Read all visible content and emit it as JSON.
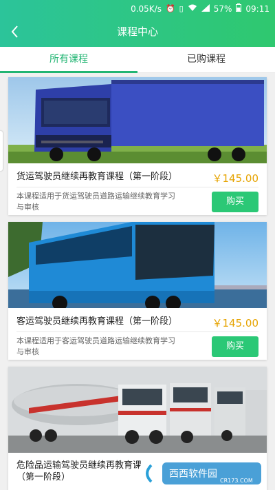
{
  "status_bar": {
    "net_speed": "0.05K/s",
    "battery": "57%",
    "time": "09:11",
    "icons": [
      "alarm-icon",
      "vibrate-icon",
      "wifi-icon",
      "signal-icon",
      "battery-icon"
    ]
  },
  "nav": {
    "title": "课程中心",
    "back_icon": "chevron-left-icon"
  },
  "tabs": [
    {
      "label": "所有课程",
      "active": true
    },
    {
      "label": "已购课程",
      "active": false
    }
  ],
  "courses": [
    {
      "title": "货运驾驶员继续再教育课程（第一阶段）",
      "price": "￥145.00",
      "desc": "本课程适用于货运驾驶员道路运输继续教育学习与审核",
      "buy_label": "购买",
      "image": "blue-cargo-truck"
    },
    {
      "title": "客运驾驶员继续再教育课程（第一阶段）",
      "price": "￥145.00",
      "desc": "本课程适用于客运驾驶员道路运输继续教育学习与审核",
      "buy_label": "购买",
      "image": "blue-coach-bus"
    },
    {
      "title_line1": "危险品运输驾驶员继续再教育课",
      "title_line2": "（第一阶段）",
      "image": "tanker-trucks"
    }
  ],
  "watermark": {
    "brand": "西西软件园",
    "url": "CR173.COM"
  },
  "colors": {
    "accent": "#22b573",
    "price": "#e6a300",
    "buy": "#2bc876"
  }
}
